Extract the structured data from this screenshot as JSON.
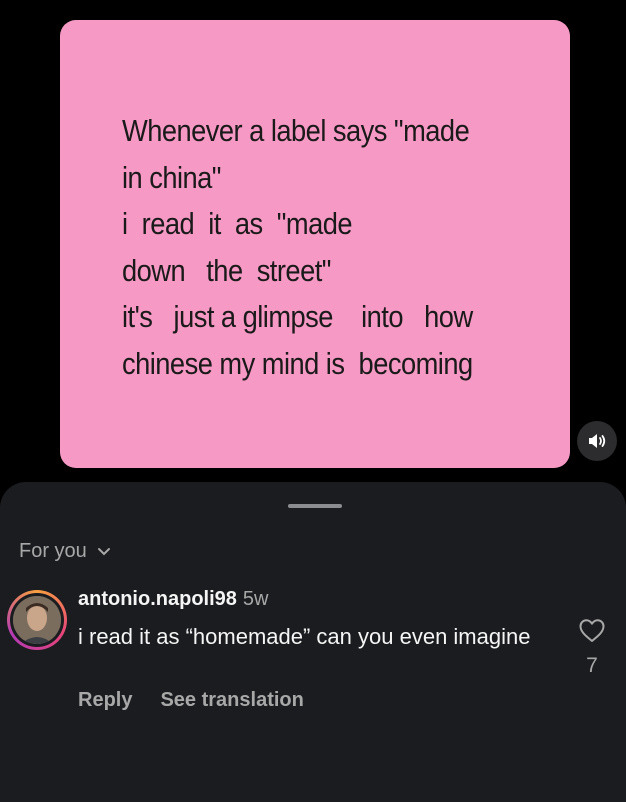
{
  "post": {
    "text": "Whenever a label says \"made\nin china\"\ni  read  it  as  \"made\ndown   the  street\"\nit's   just a glimpse    into   how\nchinese my mind is  becoming"
  },
  "comments_sheet": {
    "sort_label": "For you",
    "comment": {
      "username": "antonio.napoli98",
      "time": "5w",
      "text": "i read it as “homemade” can you even imagine",
      "reply_label": "Reply",
      "translate_label": "See translation",
      "like_count": "7"
    }
  },
  "icons": {
    "sound": "speaker-icon",
    "sort": "chevron-down-icon",
    "like": "heart-icon"
  },
  "colors": {
    "card": "#F799C5",
    "sheet": "#1A1C20",
    "muted_text": "#A8A8A8"
  }
}
